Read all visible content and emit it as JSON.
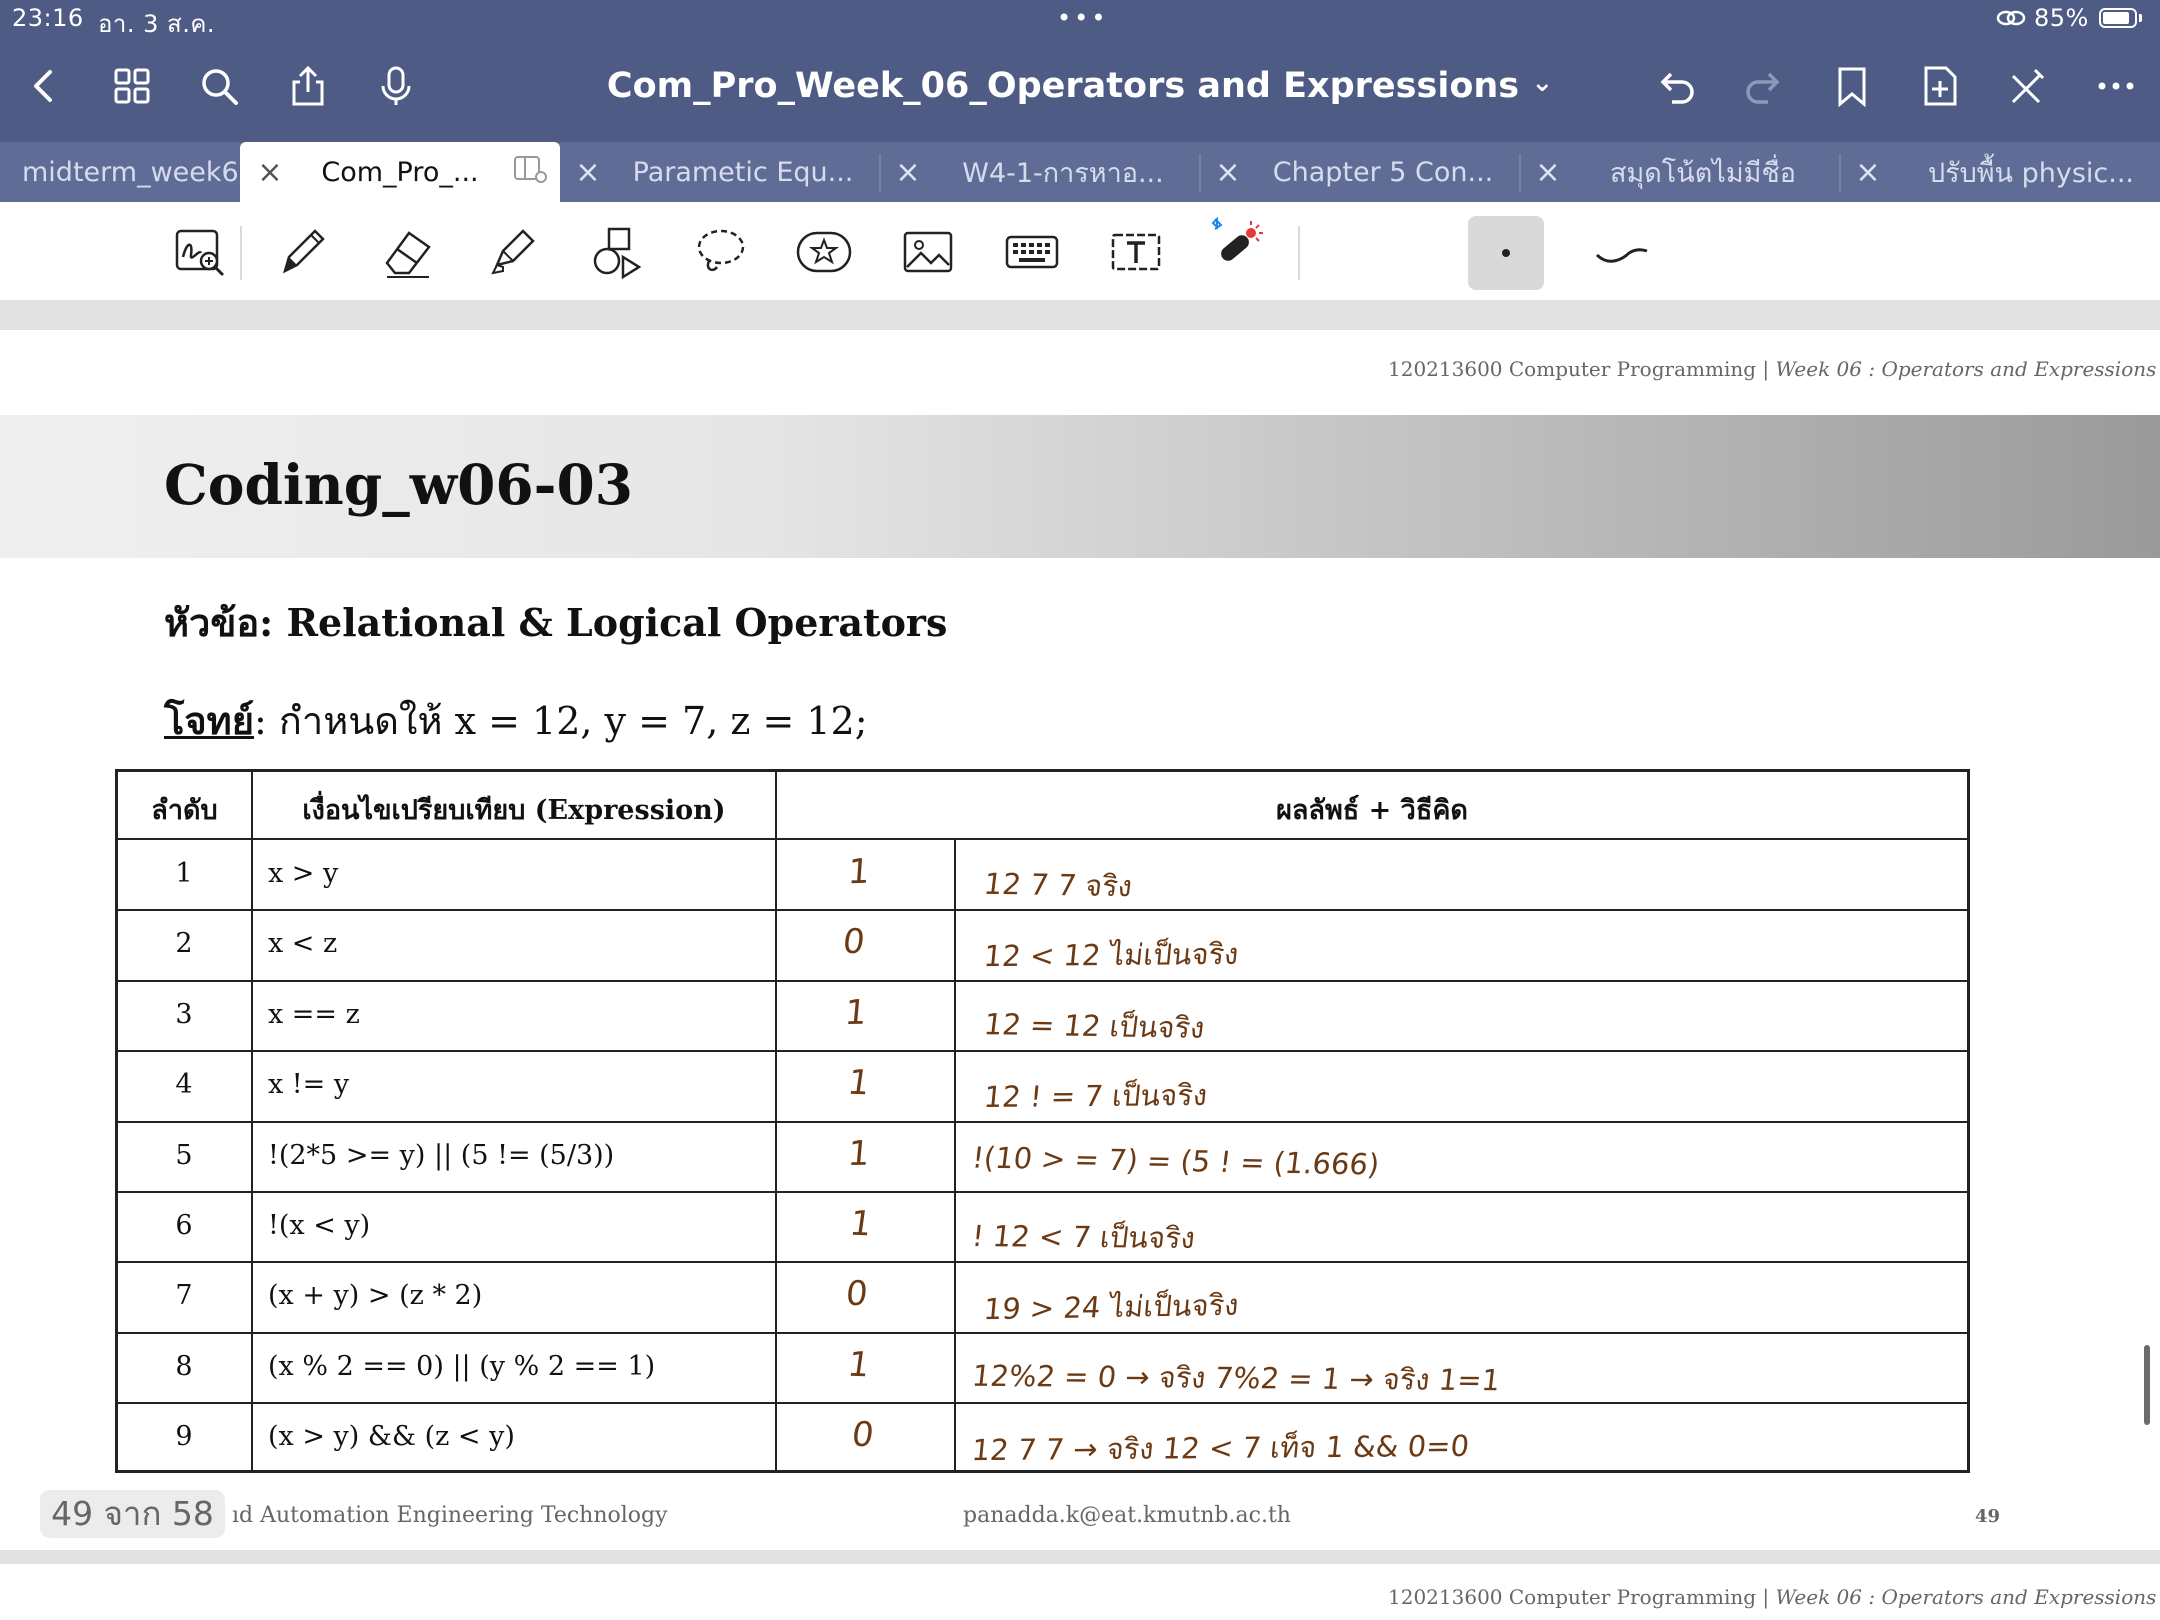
{
  "status": {
    "time": "23:16",
    "date": "อา. 3 ส.ค.",
    "battery": "85%",
    "battery_level": 0.85
  },
  "nav": {
    "title": "Com_Pro_Week_06_Operators and Expressions",
    "title_chevron": "⌄"
  },
  "tabs": [
    {
      "label": "midterm_week6",
      "active": false
    },
    {
      "label": "Com_Pro_...",
      "active": true
    },
    {
      "label": "Parametic Equ...",
      "active": false
    },
    {
      "label": "W4-1-การหาอ...",
      "active": false
    },
    {
      "label": "Chapter 5 Con...",
      "active": false
    },
    {
      "label": "สมุดโน้ตไม่มีชื่อ",
      "active": false
    },
    {
      "label": "ปรับพื้น physic...",
      "active": false
    }
  ],
  "tab_close_glyph": "×",
  "slide": {
    "header": "120213600 Computer Programming",
    "header_sep": " | ",
    "header_italic": "Week 06 : Operators and Expressions",
    "title": "Coding_w06-03",
    "topic": "หัวข้อ: Relational & Logical Operators",
    "problem_label": "โจทย์",
    "problem_text": ": กำหนดให้ x = 12, y = 7, z = 12;",
    "table": {
      "headers": [
        "ลำดับ",
        "เงื่อนไขเปรียบเทียบ (Expression)",
        "ผลลัพธ์ + วิธีคิด"
      ],
      "rows": [
        {
          "n": "1",
          "expr": "x > y",
          "ans": "1",
          "note": "12 7 7   จริง"
        },
        {
          "n": "2",
          "expr": "x < z",
          "ans": "0",
          "note": "12 < 12   ไม่เป็นจริง"
        },
        {
          "n": "3",
          "expr": "x == z",
          "ans": "1",
          "note": "12 = 12   เป็นจริง"
        },
        {
          "n": "4",
          "expr": "x != y",
          "ans": "1",
          "note": "12 ! = 7   เป็นจริง"
        },
        {
          "n": "5",
          "expr": "!(2*5 >= y) || (5 != (5/3))",
          "ans": "1",
          "note": "!(10 > = 7) = (5 ! = (1.666)"
        },
        {
          "n": "6",
          "expr": "!(x < y)",
          "ans": "1",
          "note": "! 12 < 7     เป็นจริง"
        },
        {
          "n": "7",
          "expr": "(x + y) > (z * 2)",
          "ans": "0",
          "note": "19  > 24   ไม่เป็นจริง"
        },
        {
          "n": "8",
          "expr": "(x % 2 == 0) || (y % 2 == 1)",
          "ans": "1",
          "note": "12%2 = 0 → จริง  7%2 = 1 → จริง     1=1"
        },
        {
          "n": "9",
          "expr": "(x > y) && (z < y)",
          "ans": "0",
          "note": "12 7 7 → จริง   12 < 7 เท็จ   1 && 0=0"
        }
      ]
    },
    "footer_left": "ıd Automation Engineering Technology",
    "footer_email": "panadda.k@eat.kmutnb.ac.th",
    "footer_page": "49"
  },
  "pager": "49 จาก 58",
  "colors": {
    "nav_bg": "#4e5b84",
    "tab_bg": "#5f6d96",
    "ink": "#6b3a14"
  }
}
